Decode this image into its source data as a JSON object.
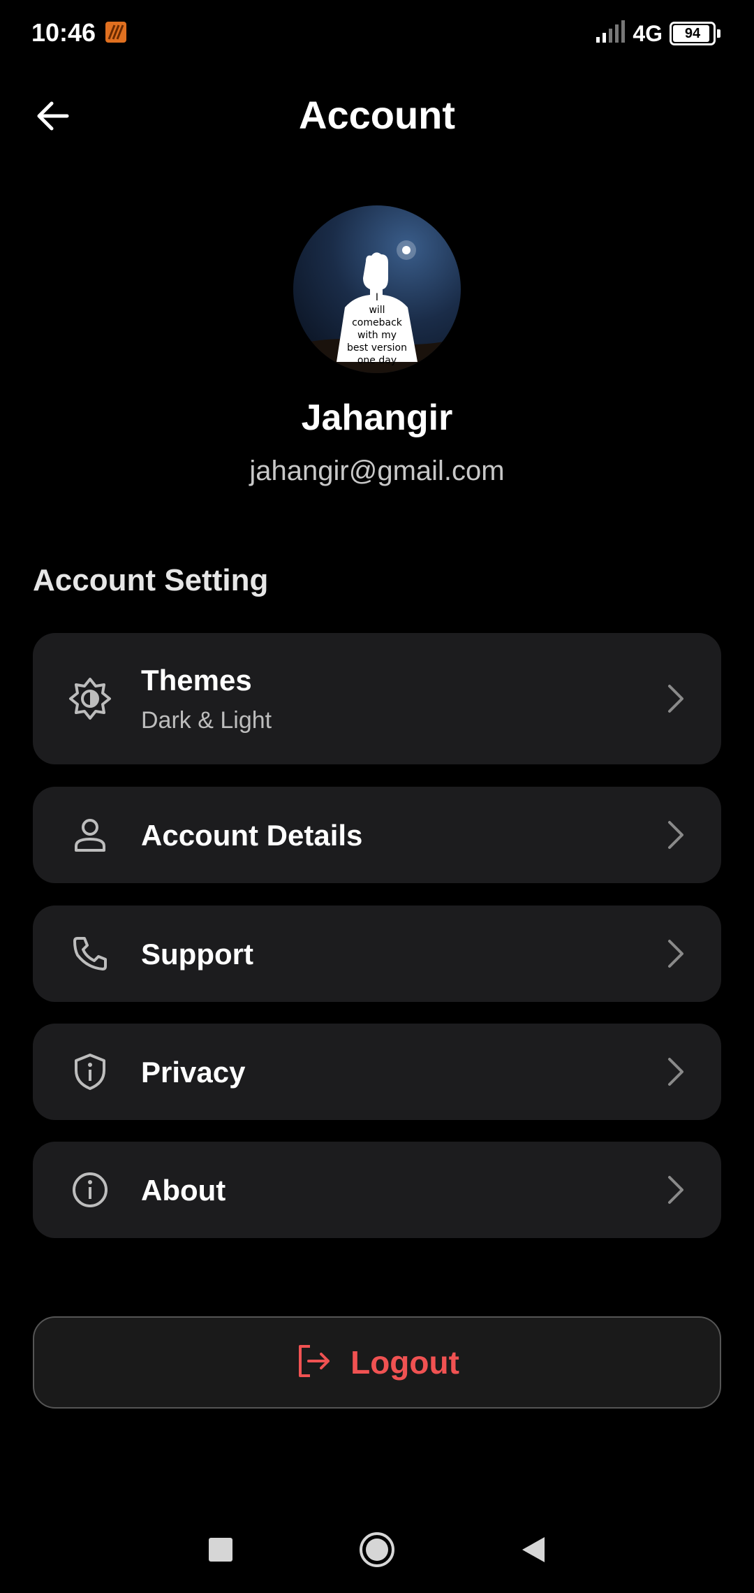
{
  "status_bar": {
    "time": "10:46",
    "network": "4G",
    "battery_level": "94",
    "battery_percent": 94,
    "app_icon": "flame-app-icon"
  },
  "header": {
    "title": "Account",
    "back_icon": "arrow-left-icon"
  },
  "profile": {
    "name": "Jahangir",
    "email": "jahangir@gmail.com",
    "avatar_lines": [
      "I",
      "will",
      "comeback",
      "with my",
      "best version",
      "one day"
    ]
  },
  "section_title": "Account Setting",
  "items": [
    {
      "label": "Themes",
      "sublabel": "Dark & Light",
      "icon": "brightness-icon"
    },
    {
      "label": "Account Details",
      "icon": "person-icon"
    },
    {
      "label": "Support",
      "icon": "phone-icon"
    },
    {
      "label": "Privacy",
      "icon": "shield-icon"
    },
    {
      "label": "About",
      "icon": "info-icon"
    }
  ],
  "logout": {
    "label": "Logout",
    "icon": "logout-icon"
  },
  "colors": {
    "background": "#000000",
    "card": "#1c1c1e",
    "logout_accent": "#f05252",
    "icon": "#bdbdbd"
  },
  "nav": [
    "recents-icon",
    "home-icon",
    "back-triangle-icon"
  ]
}
